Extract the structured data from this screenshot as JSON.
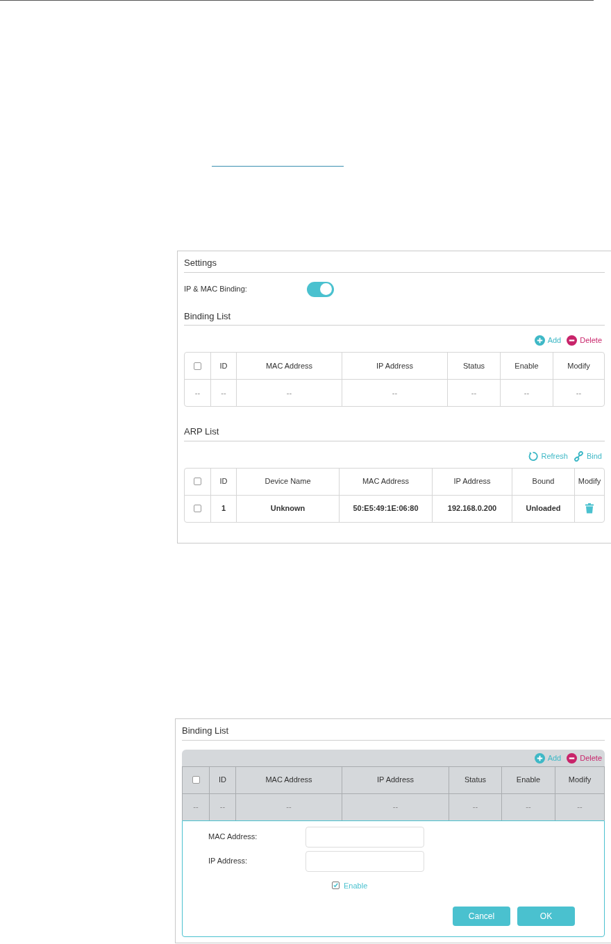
{
  "settings_panel": {
    "title": "Settings",
    "binding_toggle": {
      "label": "IP & MAC Binding:",
      "on": true
    },
    "binding_list": {
      "title": "Binding List",
      "actions": [
        {
          "kind": "add",
          "label": "Add"
        },
        {
          "kind": "delete",
          "label": "Delete"
        }
      ],
      "select_all": {
        "checked": false
      },
      "columns": [
        "ID",
        "MAC Address",
        "IP Address",
        "Status",
        "Enable",
        "Modify"
      ],
      "rows": [
        {
          "marker": "--",
          "cells": [
            "--",
            "--",
            "--",
            "--",
            "--",
            "--"
          ]
        }
      ]
    },
    "arp_list": {
      "title": "ARP List",
      "actions": [
        {
          "kind": "refresh",
          "label": "Refresh"
        },
        {
          "kind": "bind",
          "label": "Bind"
        }
      ],
      "select_all": {
        "checked": false
      },
      "columns": [
        "ID",
        "Device Name",
        "MAC Address",
        "IP Address",
        "Bound",
        "Modify"
      ],
      "rows": [
        {
          "checked": false,
          "cells": [
            "1",
            "Unknown",
            "50:E5:49:1E:06:80",
            "192.168.0.200",
            "Unloaded"
          ],
          "deletable": true
        }
      ]
    }
  },
  "edit_panel": {
    "title": "Binding List",
    "actions": [
      {
        "kind": "add",
        "label": "Add"
      },
      {
        "kind": "delete",
        "label": "Delete"
      }
    ],
    "select_all": {
      "checked": false
    },
    "columns": [
      "ID",
      "MAC Address",
      "IP Address",
      "Status",
      "Enable",
      "Modify"
    ],
    "rows": [
      {
        "marker": "--",
        "cells": [
          "--",
          "--",
          "--",
          "--",
          "--",
          "--"
        ]
      }
    ],
    "form": {
      "fields": [
        {
          "label": "MAC Address:"
        },
        {
          "label": "IP Address:"
        }
      ],
      "enable": {
        "label": "Enable",
        "checked": true
      },
      "buttons": [
        "Cancel",
        "OK"
      ]
    }
  }
}
